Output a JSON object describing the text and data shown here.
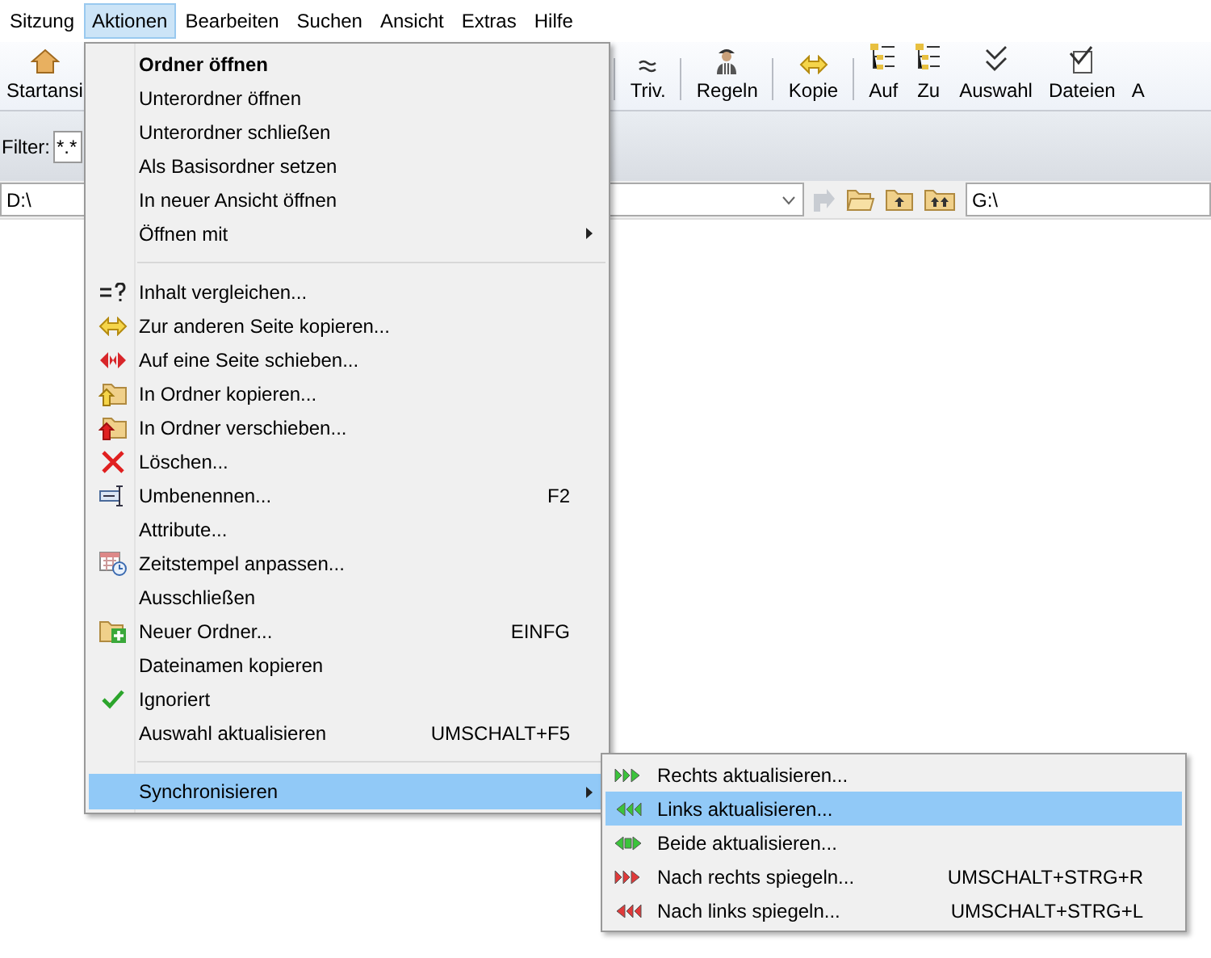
{
  "menu_bar": [
    {
      "label": "Sitzung",
      "selected": false
    },
    {
      "label": "Aktionen",
      "selected": true
    },
    {
      "label": "Bearbeiten",
      "selected": false
    },
    {
      "label": "Suchen",
      "selected": false
    },
    {
      "label": "Ansicht",
      "selected": false
    },
    {
      "label": "Extras",
      "selected": false
    },
    {
      "label": "Hilfe",
      "selected": false
    }
  ],
  "toolbar": {
    "left": [
      {
        "label": "Startansi",
        "kind": "home"
      }
    ],
    "right": [
      {
        "label": "Triv.",
        "kind": "approx",
        "separator_after": true
      },
      {
        "label": "Regeln",
        "kind": "person",
        "separator_after": true
      },
      {
        "label": "Kopie",
        "kind": "copy",
        "separator_after": true
      },
      {
        "label": "Auf",
        "kind": "expand",
        "separator_after": false
      },
      {
        "label": "Zu",
        "kind": "collapse",
        "separator_after": false
      },
      {
        "label": "Auswahl",
        "kind": "checks",
        "separator_after": false
      },
      {
        "label": "Dateien",
        "kind": "filecheck",
        "separator_after": false
      },
      {
        "label": "A",
        "kind": "plain",
        "separator_after": false
      }
    ]
  },
  "filter": {
    "label": "Filter:",
    "value": "*.*"
  },
  "left_path": {
    "value": "D:\\"
  },
  "right_path": {
    "value": "G:\\"
  },
  "actions_menu": [
    {
      "kind": "plain",
      "label": "Ordner öffnen",
      "bold": true,
      "submenu": false,
      "checked": false,
      "selected": false
    },
    {
      "kind": "plain",
      "label": "Unterordner öffnen",
      "bold": false,
      "submenu": false,
      "checked": false,
      "selected": false
    },
    {
      "kind": "plain",
      "label": "Unterordner schließen",
      "bold": false,
      "submenu": false,
      "checked": false,
      "selected": false
    },
    {
      "kind": "plain",
      "label": "Als Basisordner setzen",
      "bold": false,
      "submenu": false,
      "checked": false,
      "selected": false
    },
    {
      "kind": "plain",
      "label": "In neuer Ansicht öffnen",
      "bold": false,
      "submenu": false,
      "checked": false,
      "selected": false
    },
    {
      "kind": "plain",
      "label": "Öffnen mit",
      "bold": false,
      "submenu": true,
      "checked": false,
      "selected": false
    },
    {
      "kind": "separator"
    },
    {
      "kind": "compare",
      "label": "Inhalt vergleichen...",
      "bold": false,
      "submenu": false,
      "checked": false,
      "selected": false
    },
    {
      "kind": "copy",
      "label": "Zur anderen Seite kopieren...",
      "bold": false,
      "submenu": false,
      "checked": false,
      "selected": false
    },
    {
      "kind": "move",
      "label": "Auf eine Seite schieben...",
      "bold": false,
      "submenu": false,
      "checked": false,
      "selected": false
    },
    {
      "kind": "foldercopy",
      "label": "In Ordner kopieren...",
      "bold": false,
      "submenu": false,
      "checked": false,
      "selected": false
    },
    {
      "kind": "foldermove",
      "label": "In Ordner verschieben...",
      "bold": false,
      "submenu": false,
      "checked": false,
      "selected": false
    },
    {
      "kind": "delete",
      "label": "Löschen...",
      "bold": false,
      "submenu": false,
      "checked": false,
      "selected": false
    },
    {
      "kind": "rename",
      "label": "Umbenennen...",
      "shortcut": "F2",
      "bold": false,
      "submenu": false,
      "checked": false,
      "selected": false
    },
    {
      "kind": "plain",
      "label": "Attribute...",
      "bold": false,
      "submenu": false,
      "checked": false,
      "selected": false
    },
    {
      "kind": "calendar",
      "label": "Zeitstempel anpassen...",
      "bold": false,
      "submenu": false,
      "checked": false,
      "selected": false
    },
    {
      "kind": "plain",
      "label": "Ausschließen",
      "bold": false,
      "submenu": false,
      "checked": false,
      "selected": false
    },
    {
      "kind": "newfolder",
      "label": "Neuer Ordner...",
      "shortcut": "EINFG",
      "bold": false,
      "submenu": false,
      "checked": false,
      "selected": false
    },
    {
      "kind": "plain",
      "label": "Dateinamen kopieren",
      "bold": false,
      "submenu": false,
      "checked": false,
      "selected": false
    },
    {
      "kind": "plain",
      "label": "Ignoriert",
      "bold": false,
      "submenu": false,
      "checked": true,
      "selected": false
    },
    {
      "kind": "plain",
      "label": "Auswahl aktualisieren",
      "shortcut": "UMSCHALT+F5",
      "bold": false,
      "submenu": false,
      "checked": false,
      "selected": false
    },
    {
      "kind": "separator"
    },
    {
      "kind": "plain",
      "label": "Synchronisieren",
      "bold": false,
      "submenu": true,
      "checked": false,
      "selected": true
    }
  ],
  "sync_submenu": [
    {
      "label": "Rechts aktualisieren...",
      "kind": "green-right",
      "selected": false
    },
    {
      "label": "Links aktualisieren...",
      "kind": "green-left",
      "selected": true
    },
    {
      "label": "Beide aktualisieren...",
      "kind": "green-both",
      "selected": false
    },
    {
      "label": "Nach rechts spiegeln...",
      "kind": "red-right",
      "shortcut": "UMSCHALT+STRG+R",
      "selected": false
    },
    {
      "label": "Nach links spiegeln...",
      "kind": "red-left",
      "shortcut": "UMSCHALT+STRG+L",
      "selected": false
    }
  ]
}
